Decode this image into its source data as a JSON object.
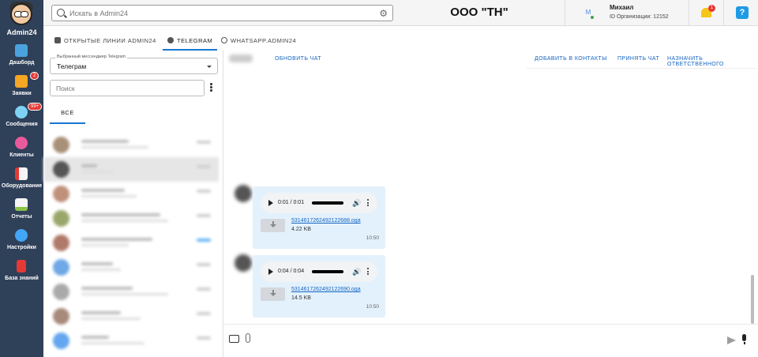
{
  "app": {
    "name": "Admin24"
  },
  "sidebar": {
    "items": [
      {
        "label": "Дашборд",
        "icon": "dashboard-icon",
        "color": "#4aa3df"
      },
      {
        "label": "Заявки",
        "icon": "megaphone-icon",
        "color": "#f5a623",
        "badge": "2"
      },
      {
        "label": "Сообщения",
        "icon": "chat-bubbles-icon",
        "color": "#7ed3f5",
        "badge": "99+"
      },
      {
        "label": "Клиенты",
        "icon": "clients-icon",
        "color": "#e85a9b"
      },
      {
        "label": "Оборудование",
        "icon": "equipment-icon",
        "color": "#e53935"
      },
      {
        "label": "Отчеты",
        "icon": "report-icon",
        "color": "#8bc34a"
      },
      {
        "label": "Настройки",
        "icon": "gear-icon",
        "color": "#42a5f5"
      },
      {
        "label": "База знаний",
        "icon": "book-icon",
        "color": "#e53935"
      }
    ]
  },
  "topbar": {
    "search_placeholder": "Искать в Admin24",
    "org_title": "ООО \"ТН\"",
    "user_initial": "М",
    "user_name": "Михаил",
    "user_org": "ID Организации: 12152",
    "notifications": "1",
    "help": "?"
  },
  "tabs": [
    {
      "label": "ОТКРЫТЫЕ ЛИНИИ ADMIN24",
      "icon": "people-icon",
      "active": false
    },
    {
      "label": "TELEGRAM",
      "icon": "telegram-icon",
      "active": true
    },
    {
      "label": "WHATSAPP.ADMIN24",
      "icon": "whatsapp-icon",
      "active": false
    }
  ],
  "left_panel": {
    "messenger_label": "Выбранный мессенджер Telegram",
    "messenger_value": "Телеграм",
    "filter_placeholder": "Поиск",
    "all_tab": "ВСЕ"
  },
  "chat_header": {
    "refresh": "ОБНОВИТЬ ЧАТ",
    "add_contact": "ДОБАВИТЬ В КОНТАКТЫ",
    "accept": "ПРИНЯТЬ ЧАТ",
    "assign": "НАЗНАЧИТЬ ОТВЕТСТВЕННОГО"
  },
  "messages": [
    {
      "player_time": "0:01 / 0:01",
      "progress": 1.0,
      "file_name": "5314617262492122688.oga",
      "file_size": "4.22 KB",
      "time": "10:50"
    },
    {
      "player_time": "0:04 / 0:04",
      "progress": 1.0,
      "file_name": "5314617262492122690.oga",
      "file_size": "14.5 KB",
      "time": "10:50"
    }
  ],
  "colors": {
    "sidebar": "#2f4059",
    "accent": "#1976d2",
    "bubble": "#e3f1fc",
    "link": "#1565c0"
  }
}
